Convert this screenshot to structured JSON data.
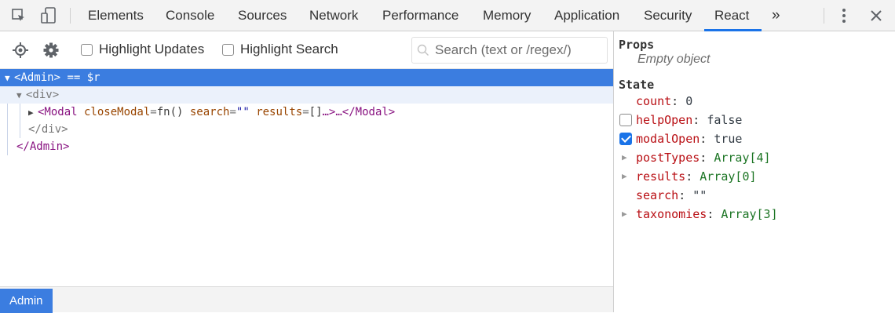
{
  "topbar": {
    "tabs": [
      {
        "label": "Elements"
      },
      {
        "label": "Console"
      },
      {
        "label": "Sources"
      },
      {
        "label": "Network"
      },
      {
        "label": "Performance"
      },
      {
        "label": "Memory"
      },
      {
        "label": "Application"
      },
      {
        "label": "Security"
      },
      {
        "label": "React",
        "active": true
      }
    ],
    "overflow_label": "»",
    "icons": [
      "inspect-icon",
      "device-toggle-icon",
      "more-options-icon",
      "close-icon"
    ]
  },
  "toolbar": {
    "highlight_updates_label": "Highlight Updates",
    "highlight_search_label": "Highlight Search",
    "search_placeholder": "Search (text or /regex/)"
  },
  "tree": {
    "admin_open": "<Admin>",
    "admin_ref": " == $r",
    "div_open": "<div>",
    "modal_lt": "<Modal",
    "modal_attr1_name": " closeModal",
    "modal_attr1_eq": "=",
    "modal_attr1_val": "fn()",
    "modal_attr2_name": " search",
    "modal_attr2_eq": "=",
    "modal_attr2_val": "\"\"",
    "modal_attr3_name": " results",
    "modal_attr3_eq": "=",
    "modal_attr3_val": "[]",
    "modal_ellipsis": "…>…",
    "modal_close": "</Modal>",
    "div_close": "</div>",
    "admin_close": "</Admin>"
  },
  "breadcrumb": {
    "active": "Admin"
  },
  "props": {
    "title": "Props",
    "empty_text": "Empty object"
  },
  "state": {
    "title": "State",
    "items": [
      {
        "name": "count",
        "value": "0",
        "kind": "plain"
      },
      {
        "name": "helpOpen",
        "value": "false",
        "kind": "bool",
        "checked": false
      },
      {
        "name": "modalOpen",
        "value": "true",
        "kind": "bool",
        "checked": true
      },
      {
        "name": "postTypes",
        "value": "Array[4]",
        "kind": "array"
      },
      {
        "name": "results",
        "value": "Array[0]",
        "kind": "array"
      },
      {
        "name": "search",
        "value": "\"\"",
        "kind": "plain"
      },
      {
        "name": "taxonomies",
        "value": "Array[3]",
        "kind": "array"
      }
    ]
  },
  "colors": {
    "selection": "#3b7de0",
    "accent": "#1a73e8",
    "prop_name": "#b90f14",
    "array_value": "#1c7524",
    "tag": "#881280"
  }
}
